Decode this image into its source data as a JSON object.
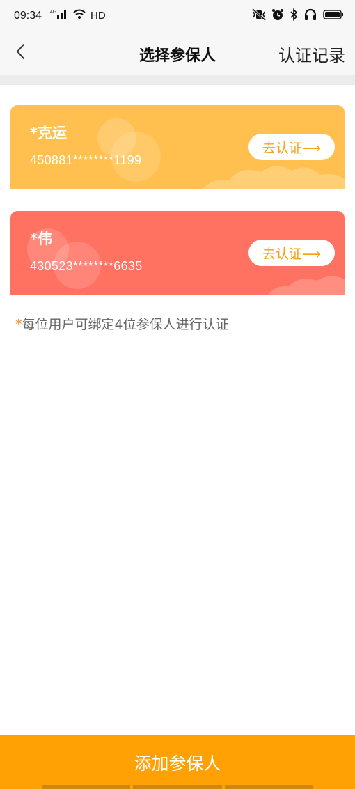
{
  "status_bar": {
    "time": "09:34",
    "network": "HD"
  },
  "nav": {
    "title": "选择参保人",
    "right_action": "认证记录",
    "back_icon": "chevron-left-icon"
  },
  "cards": [
    {
      "name": "*克运",
      "id_number": "450881********1199",
      "button_label": "去认证⟶",
      "color": "#ffc04f"
    },
    {
      "name": "*伟",
      "id_number": "430523********6635",
      "button_label": "去认证⟶",
      "color": "#ff7262"
    }
  ],
  "note": {
    "star": "*",
    "text": "每位用户可绑定4位参保人进行认证"
  },
  "footer": {
    "button_label": "添加参保人",
    "color": "#ffa005"
  }
}
